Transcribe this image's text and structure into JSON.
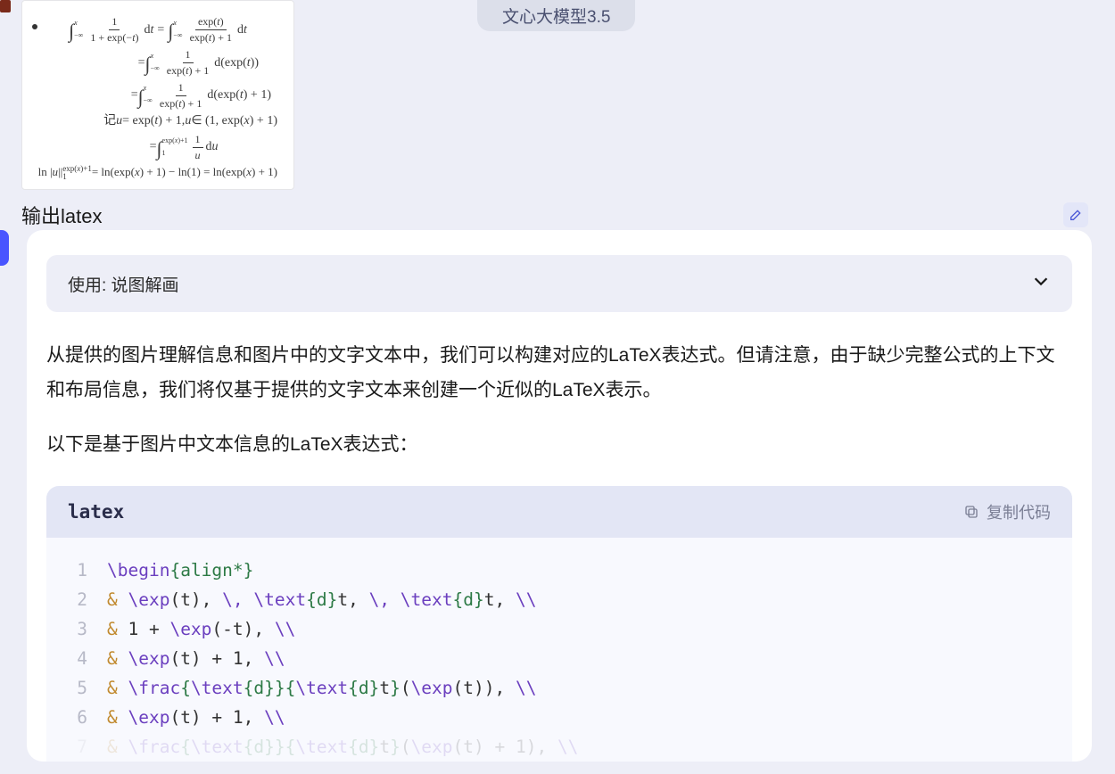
{
  "header": {
    "model_pill": "文心大模型3.5"
  },
  "user": {
    "prompt": "输出latex",
    "math_lines": [
      "∫ 1/(1+exp(−t)) dt = ∫ exp(t)/(exp(t)+1) dt  (−∞→x)",
      "= ∫ 1/(exp(t)+1) d(exp(t))  (−∞→x)",
      "= ∫ 1/(exp(t)+1) d(exp(t)+1)  (−∞→x)",
      "记 u = exp(t)+1, u ∈ (1, exp(x)+1)",
      "= ∫ 1/u du  (1→exp(x)+1)",
      "ln|u| |₁^{exp(x)+1} = ln(exp(x)+1) − ln(1) = ln(exp(x)+1)"
    ]
  },
  "assistant": {
    "accordion_label": "使用: 说图解画",
    "paragraphs": [
      "从提供的图片理解信息和图片中的文字文本中，我们可以构建对应的LaTeX表达式。但请注意，由于缺少完整公式的上下文和布局信息，我们将仅基于提供的文字文本来创建一个近似的LaTeX表示。",
      "以下是基于图片中文本信息的LaTeX表达式："
    ],
    "code": {
      "language": "latex",
      "copy_label": "复制代码",
      "lines": [
        {
          "n": "1",
          "tokens": [
            [
              "cmd",
              "\\begin"
            ],
            [
              "brace",
              "{align*}"
            ]
          ]
        },
        {
          "n": "2",
          "tokens": [
            [
              "amp",
              "& "
            ],
            [
              "cmd",
              "\\exp"
            ],
            [
              "text",
              "(t), "
            ],
            [
              "cmd",
              "\\,"
            ],
            [
              "text",
              " "
            ],
            [
              "cmd",
              "\\text"
            ],
            [
              "brace",
              "{d}"
            ],
            [
              "text",
              "t, "
            ],
            [
              "cmd",
              "\\,"
            ],
            [
              "text",
              " "
            ],
            [
              "cmd",
              "\\text"
            ],
            [
              "brace",
              "{d}"
            ],
            [
              "text",
              "t, "
            ],
            [
              "cmd",
              "\\\\"
            ]
          ]
        },
        {
          "n": "3",
          "tokens": [
            [
              "amp",
              "& "
            ],
            [
              "text",
              "1 + "
            ],
            [
              "cmd",
              "\\exp"
            ],
            [
              "text",
              "(-t), "
            ],
            [
              "cmd",
              "\\\\"
            ]
          ]
        },
        {
          "n": "4",
          "tokens": [
            [
              "amp",
              "& "
            ],
            [
              "cmd",
              "\\exp"
            ],
            [
              "text",
              "(t) + 1, "
            ],
            [
              "cmd",
              "\\\\"
            ]
          ]
        },
        {
          "n": "5",
          "tokens": [
            [
              "amp",
              "& "
            ],
            [
              "cmd",
              "\\frac"
            ],
            [
              "brace",
              "{"
            ],
            [
              "cmd",
              "\\text"
            ],
            [
              "brace",
              "{d}"
            ],
            [
              "brace",
              "}"
            ],
            [
              "brace",
              "{"
            ],
            [
              "cmd",
              "\\text"
            ],
            [
              "brace",
              "{d}"
            ],
            [
              "text",
              "t"
            ],
            [
              "brace",
              "}"
            ],
            [
              "text",
              "("
            ],
            [
              "cmd",
              "\\exp"
            ],
            [
              "text",
              "(t)), "
            ],
            [
              "cmd",
              "\\\\"
            ]
          ]
        },
        {
          "n": "6",
          "tokens": [
            [
              "amp",
              "& "
            ],
            [
              "cmd",
              "\\exp"
            ],
            [
              "text",
              "(t) + 1, "
            ],
            [
              "cmd",
              "\\\\"
            ]
          ]
        },
        {
          "n": "7",
          "faded": true,
          "tokens": [
            [
              "amp",
              "& "
            ],
            [
              "cmd",
              "\\frac"
            ],
            [
              "brace",
              "{"
            ],
            [
              "cmd",
              "\\text"
            ],
            [
              "brace",
              "{d}"
            ],
            [
              "brace",
              "}"
            ],
            [
              "brace",
              "{"
            ],
            [
              "cmd",
              "\\text"
            ],
            [
              "brace",
              "{d}"
            ],
            [
              "text",
              "t"
            ],
            [
              "brace",
              "}"
            ],
            [
              "text",
              "("
            ],
            [
              "cmd",
              "\\exp"
            ],
            [
              "text",
              "(t) + 1), "
            ],
            [
              "cmd",
              "\\\\"
            ]
          ]
        }
      ]
    }
  }
}
